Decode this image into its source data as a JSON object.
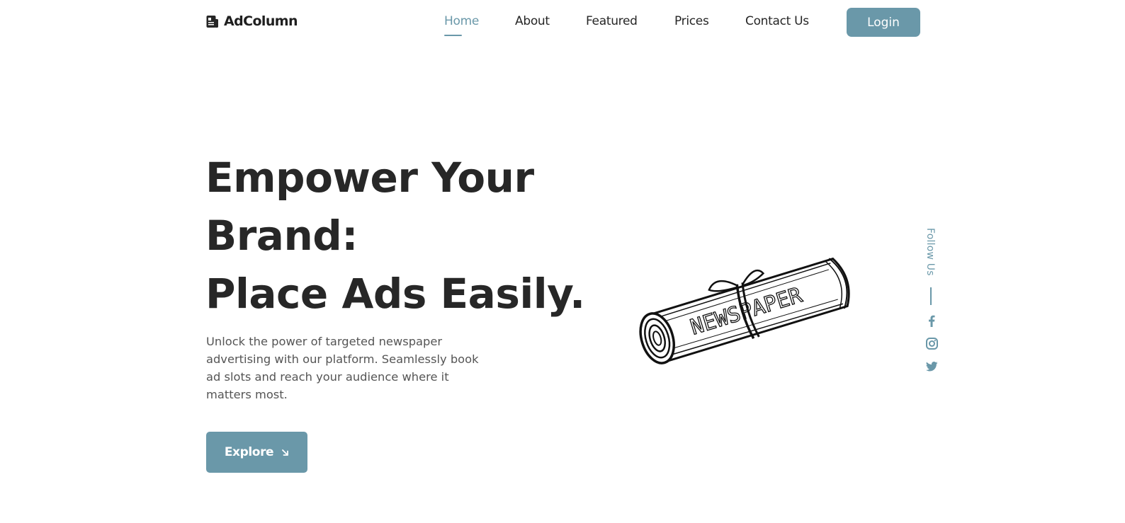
{
  "brand": {
    "name": "AdColumn",
    "icon": "newspaper-icon"
  },
  "nav": {
    "items": [
      {
        "label": "Home",
        "active": true
      },
      {
        "label": "About",
        "active": false
      },
      {
        "label": "Featured",
        "active": false
      },
      {
        "label": "Prices",
        "active": false
      },
      {
        "label": "Contact Us",
        "active": false
      }
    ],
    "login_label": "Login"
  },
  "hero": {
    "headline": [
      "Empower Your",
      "Brand:",
      "Place Ads Easily."
    ],
    "description": "Unlock the power of targeted newspaper advertising with our platform. Seamlessly book ad slots and reach your audience where it matters most.",
    "cta_label": "Explore",
    "cta_icon": "arrow-down-right-icon",
    "illustration": "rolled-newspaper-sketch",
    "illustration_text": "NEWSPAPER"
  },
  "social": {
    "label": "Follow Us",
    "links": [
      "facebook-icon",
      "instagram-icon",
      "twitter-icon"
    ]
  },
  "colors": {
    "accent": "#6a98a9",
    "heading": "#272727",
    "body_text": "#555555",
    "background": "#ffffff"
  }
}
